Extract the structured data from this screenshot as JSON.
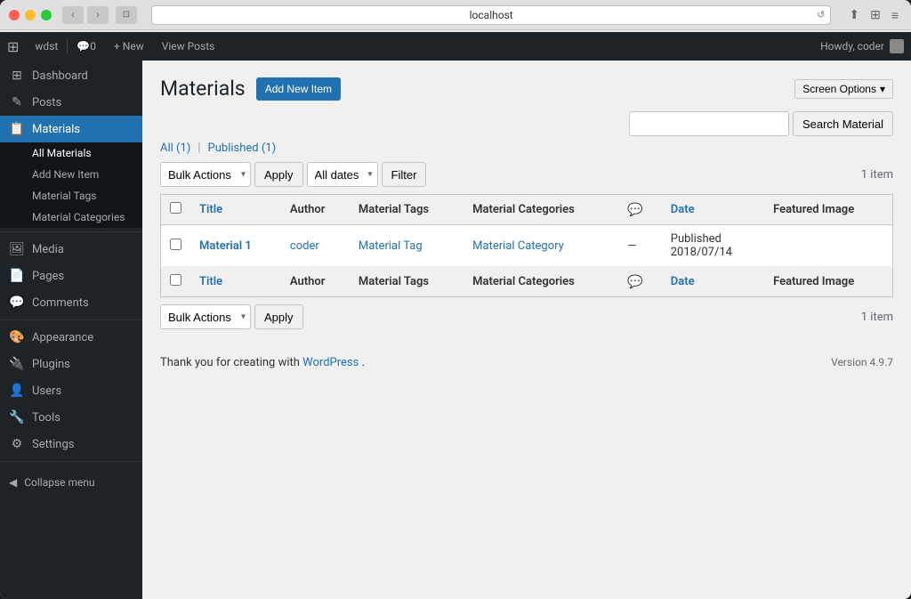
{
  "browser": {
    "url": "localhost",
    "back_btn": "‹",
    "forward_btn": "›"
  },
  "admin_bar": {
    "wp_logo": "W",
    "site_name": "wdst",
    "comment_count": "0",
    "new_label": "+ New",
    "view_posts": "View Posts",
    "howdy": "Howdy, coder"
  },
  "screen_options": {
    "label": "Screen Options",
    "arrow": "▾"
  },
  "sidebar": {
    "items": [
      {
        "id": "dashboard",
        "icon": "⊞",
        "label": "Dashboard"
      },
      {
        "id": "posts",
        "icon": "✎",
        "label": "Posts"
      },
      {
        "id": "materials",
        "icon": "📋",
        "label": "Materials",
        "active": true
      }
    ],
    "materials_sub": [
      {
        "id": "all-materials",
        "label": "All Materials",
        "active": true
      },
      {
        "id": "add-new-item",
        "label": "Add New Item"
      },
      {
        "id": "material-tags",
        "label": "Material Tags"
      },
      {
        "id": "material-categories",
        "label": "Material Categories"
      }
    ],
    "items2": [
      {
        "id": "media",
        "icon": "🖼",
        "label": "Media"
      },
      {
        "id": "pages",
        "icon": "📄",
        "label": "Pages"
      },
      {
        "id": "comments",
        "icon": "💬",
        "label": "Comments"
      },
      {
        "id": "appearance",
        "icon": "🎨",
        "label": "Appearance"
      },
      {
        "id": "plugins",
        "icon": "🔌",
        "label": "Plugins"
      },
      {
        "id": "users",
        "icon": "👤",
        "label": "Users"
      },
      {
        "id": "tools",
        "icon": "🔧",
        "label": "Tools"
      },
      {
        "id": "settings",
        "icon": "⚙",
        "label": "Settings"
      }
    ],
    "collapse_label": "Collapse menu"
  },
  "page": {
    "title": "Materials",
    "add_new_label": "Add New Item",
    "filter_all": "All",
    "filter_all_count": "(1)",
    "filter_separator": "|",
    "filter_published": "Published",
    "filter_published_count": "(1)"
  },
  "table_controls_top": {
    "bulk_actions_placeholder": "Bulk Actions",
    "apply_label": "Apply",
    "date_placeholder": "All dates",
    "filter_label": "Filter",
    "item_count": "1 item",
    "search_placeholder": "",
    "search_button": "Search Material"
  },
  "table_controls_bottom": {
    "bulk_actions_placeholder": "Bulk Actions",
    "apply_label": "Apply",
    "item_count": "1 item"
  },
  "table": {
    "headers": [
      {
        "id": "title",
        "label": "Title",
        "sortable": true
      },
      {
        "id": "author",
        "label": "Author",
        "sortable": false
      },
      {
        "id": "tags",
        "label": "Material Tags",
        "sortable": false
      },
      {
        "id": "categories",
        "label": "Material Categories",
        "sortable": false
      },
      {
        "id": "comments",
        "label": "💬",
        "sortable": false
      },
      {
        "id": "date",
        "label": "Date",
        "sortable": true
      },
      {
        "id": "featured_image",
        "label": "Featured Image",
        "sortable": false
      }
    ],
    "rows": [
      {
        "id": 1,
        "title": "Material 1",
        "author": "coder",
        "tags": "Material Tag",
        "categories": "Material Category",
        "comments": "—",
        "date_status": "Published",
        "date_value": "2018/07/14",
        "featured_image": ""
      }
    ],
    "footer_headers": [
      {
        "id": "title2",
        "label": "Title",
        "sortable": true
      },
      {
        "id": "author2",
        "label": "Author",
        "sortable": false
      },
      {
        "id": "tags2",
        "label": "Material Tags",
        "sortable": false
      },
      {
        "id": "categories2",
        "label": "Material Categories",
        "sortable": false
      },
      {
        "id": "comments2",
        "label": "💬",
        "sortable": false
      },
      {
        "id": "date2",
        "label": "Date",
        "sortable": true
      },
      {
        "id": "featured_image2",
        "label": "Featured Image",
        "sortable": false
      }
    ]
  },
  "footer": {
    "thank_you": "Thank you for creating with ",
    "wp_link_text": "WordPress",
    "period": ".",
    "version": "Version 4.9.7"
  }
}
